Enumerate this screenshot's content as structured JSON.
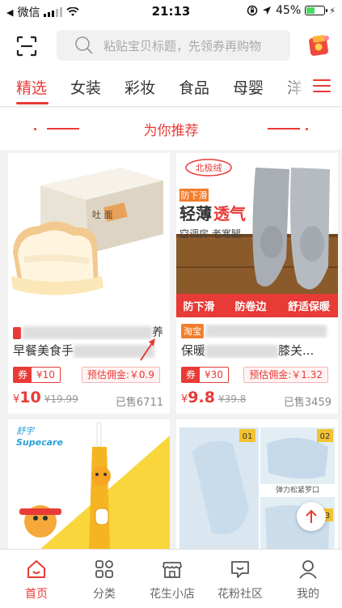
{
  "status_bar": {
    "carrier": "微信",
    "time": "21:13",
    "battery": "45%",
    "battery_level": 0.45
  },
  "search": {
    "placeholder": "粘贴宝贝标题，先领券再购物"
  },
  "tabs": [
    {
      "label": "精选",
      "active": true
    },
    {
      "label": "女装",
      "active": false
    },
    {
      "label": "彩妆",
      "active": false
    },
    {
      "label": "食品",
      "active": false
    },
    {
      "label": "母婴",
      "active": false
    },
    {
      "label": "洋",
      "active": false
    }
  ],
  "section": {
    "title": "为你推荐"
  },
  "products": [
    {
      "image_label": "吐 面",
      "shop_badge": "",
      "title_visible_start": "",
      "title_visible_end": "养",
      "desc_start": "早餐美食手",
      "desc_end": "",
      "coupon_prefix": "券",
      "coupon_value": "¥10",
      "commission": "预估佣金:￥0.9",
      "price_symbol": "¥",
      "price": "10",
      "original_price": "¥19.99",
      "sold": "已售6711"
    },
    {
      "image_label": "",
      "shop_badge": "淘宝",
      "title_visible_start": "",
      "title_visible_end": "",
      "desc_start": "保暖",
      "desc_end": "膝关...",
      "coupon_prefix": "券",
      "coupon_value": "¥30",
      "commission": "预估佣金:￥1.32",
      "price_symbol": "¥",
      "price": "9.8",
      "original_price": "¥39.8",
      "sold": "已售3459"
    }
  ],
  "product_images": {
    "card2": {
      "brand": "北极绒",
      "tag": "防下滑",
      "headline_1": "轻薄",
      "headline_2": "透气",
      "subline": "空调房 老寒腿",
      "banner_1": "防下滑",
      "banner_2": "防卷边",
      "banner_3": "舒适保暖"
    },
    "card3": {
      "brand": "舒宇",
      "brand_en": "Supecare"
    },
    "card4": {
      "num_1": "01",
      "num_2": "02",
      "num_3": "3",
      "caption": "弹力松紧罗口"
    }
  },
  "bottom_nav": [
    {
      "label": "首页",
      "icon": "home-icon",
      "active": true
    },
    {
      "label": "分类",
      "icon": "category-icon",
      "active": false
    },
    {
      "label": "花生小店",
      "icon": "shop-icon",
      "active": false
    },
    {
      "label": "花粉社区",
      "icon": "community-icon",
      "active": false
    },
    {
      "label": "我的",
      "icon": "profile-icon",
      "active": false
    }
  ],
  "colors": {
    "accent": "#e83a36",
    "orange": "#f07e2d",
    "background": "#f2f2f2"
  }
}
